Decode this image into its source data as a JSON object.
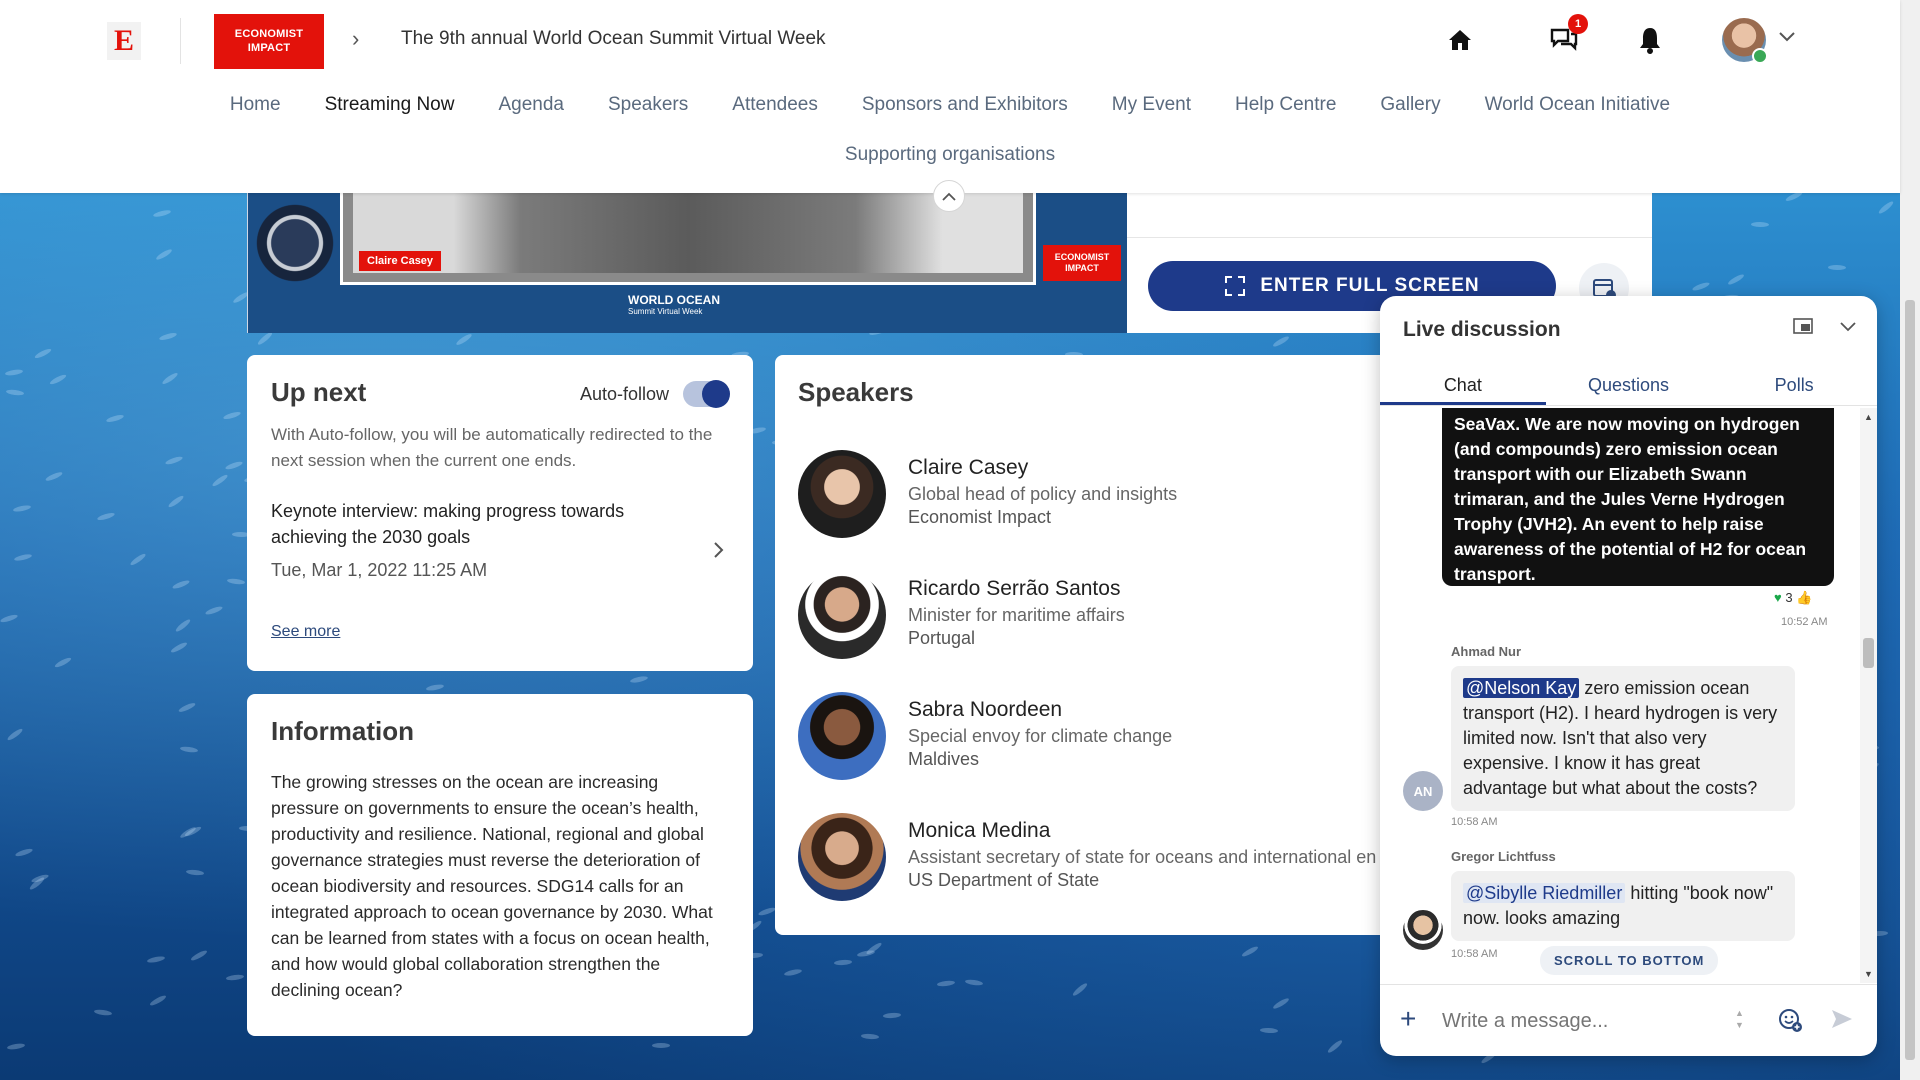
{
  "header": {
    "e_logo": "E",
    "brand_logo": "ECONOMIST IMPACT",
    "event_title": "The 9th annual World Ocean Summit Virtual Week",
    "notification_count": "1",
    "icons": [
      "home-icon",
      "chat-bubbles-icon",
      "bell-icon",
      "avatar",
      "chevron-down-icon"
    ]
  },
  "nav": {
    "items": [
      "Home",
      "Streaming Now",
      "Agenda",
      "Speakers",
      "Attendees",
      "Sponsors and Exhibitors",
      "My Event",
      "Help Centre",
      "Gallery",
      "World Ocean Initiative"
    ],
    "active": "Streaming Now",
    "second_row": "Supporting organisations"
  },
  "video": {
    "name_tag": "Claire Casey",
    "brand_small": "ECONOMIST IMPACT",
    "wo_logo": "WORLD OCEAN",
    "wo_logo_sub": "Summit Virtual Week",
    "fullscreen_label": "ENTER FULL SCREEN"
  },
  "upnext": {
    "title": "Up next",
    "autofollow_label": "Auto-follow",
    "autofollow_on": true,
    "description": "With Auto-follow, you will be automatically redirected to the next session when the current one ends.",
    "session_title": "Keynote interview: making progress towards achieving the 2030 goals",
    "session_time": "Tue, Mar 1, 2022 11:25 AM",
    "see_more": "See more"
  },
  "information": {
    "title": "Information",
    "body": "The growing stresses on the ocean are increasing pressure on governments to ensure the ocean’s health, productivity and resilience. National, regional and global governance strategies must reverse the deterioration of ocean biodiversity and resources. SDG14 calls for an integrated approach to ocean governance by 2030. What can be learned from states with a focus on ocean health, and how would global collaboration strengthen the declining ocean?"
  },
  "speakers": {
    "title": "Speakers",
    "list": [
      {
        "name": "Claire Casey",
        "role": "Global head of policy and insights",
        "org": "Economist Impact"
      },
      {
        "name": "Ricardo Serrão Santos",
        "role": "Minister for maritime affairs",
        "org": "Portugal"
      },
      {
        "name": "Sabra Noordeen",
        "role": "Special envoy for climate change",
        "org": "Maldives"
      },
      {
        "name": "Monica Medina",
        "role": "Assistant secretary of state for oceans and international en",
        "org": "US Department of State"
      }
    ]
  },
  "live": {
    "title": "Live discussion",
    "tabs": [
      "Chat",
      "Questions",
      "Polls"
    ],
    "active_tab": "Chat",
    "own_message": "SeaVax. We are now moving on hydrogen (and compounds) zero emission ocean transport with our Elizabeth Swann trimaran, and the Jules Verne Hydrogen Trophy (JVH2). An event to help raise awareness of the potential of H2 for ocean transport.",
    "own_reactions": "3",
    "own_time": "10:52 AM",
    "messages": [
      {
        "sender": "Ahmad Nur",
        "initials": "AN",
        "mention": "@Nelson Kay",
        "text": " zero emission ocean transport (H2). I heard hydrogen is very limited now. Isn't that also very expensive. I know it has great advantage but what about the costs?",
        "time": "10:58 AM"
      },
      {
        "sender": "Gregor Lichtfuss",
        "mention": "@Sibylle Riedmiller",
        "text": " hitting \"book now\" now. looks amazing",
        "time": "10:58 AM"
      }
    ],
    "scroll_to_bottom": "SCROLL TO BOTTOM",
    "composer_placeholder": "Write a message..."
  },
  "colors": {
    "brand_red": "#e3120b",
    "primary_navy": "#1e3a8a",
    "link_blue": "#2d4a7c"
  }
}
